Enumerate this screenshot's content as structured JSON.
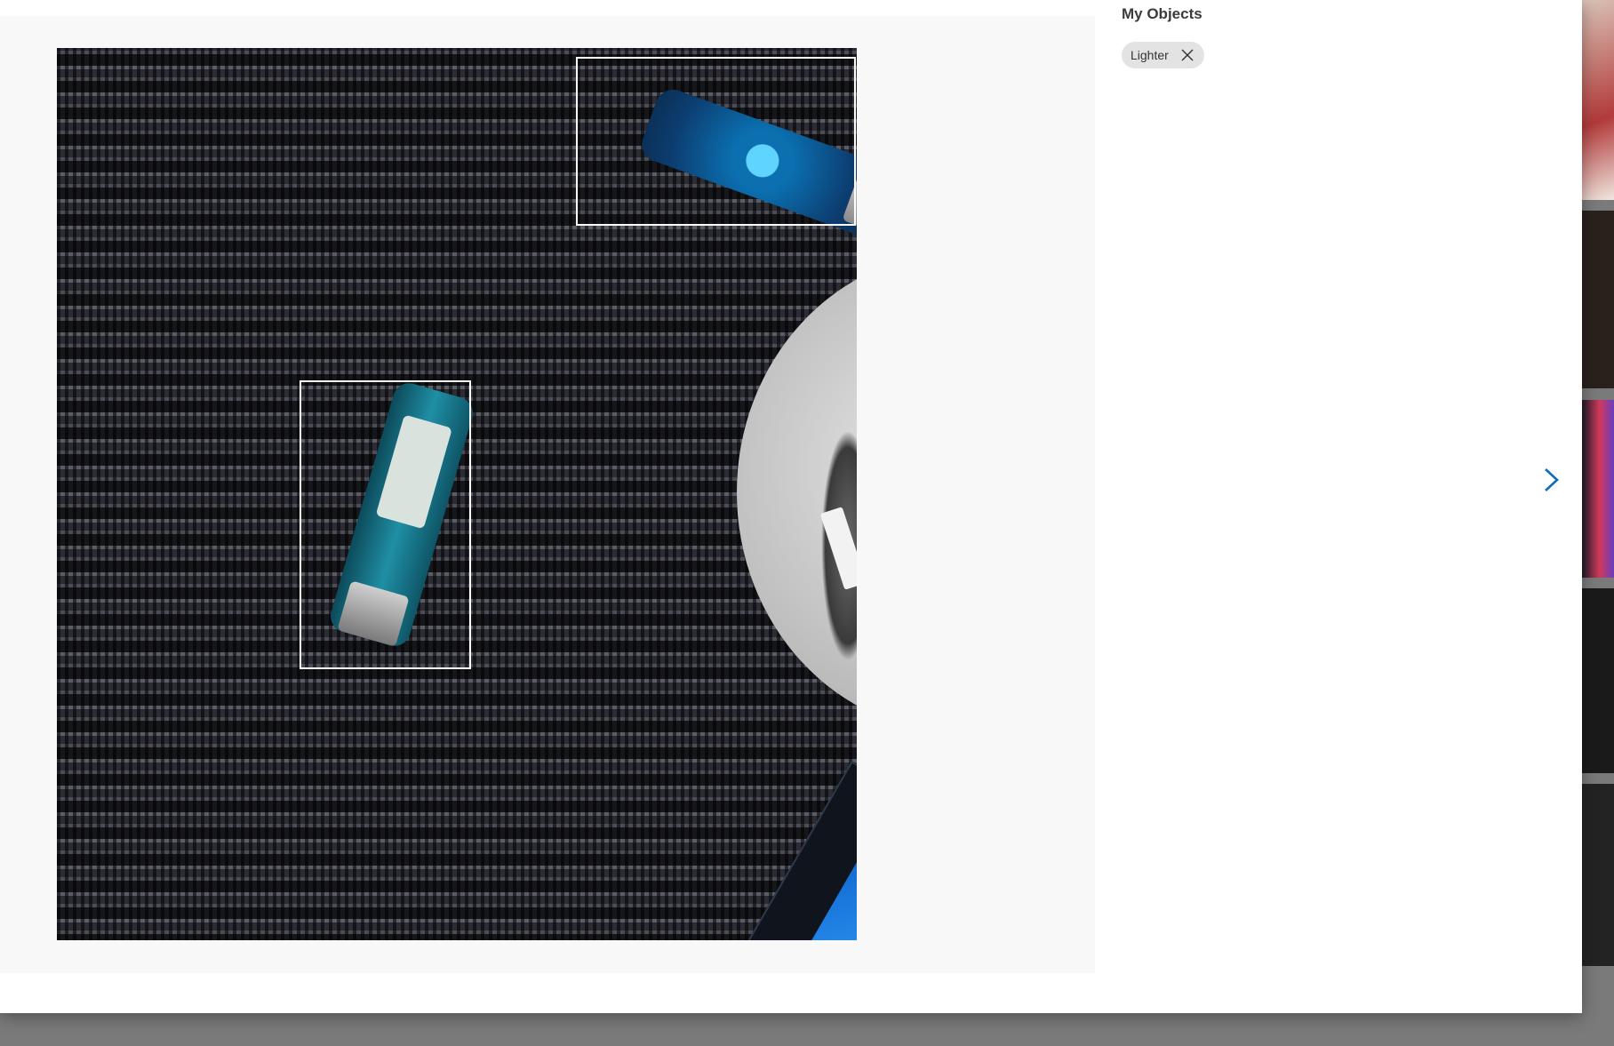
{
  "panel": {
    "title": "My Objects",
    "tags": [
      {
        "label": "Lighter",
        "remove_icon": "close-icon"
      }
    ]
  },
  "navigation": {
    "next_icon": "chevron-right-icon"
  },
  "colors": {
    "accent": "#0f6cbd",
    "tag_bg": "#e3e3e3",
    "bbox": "#ffffff"
  }
}
